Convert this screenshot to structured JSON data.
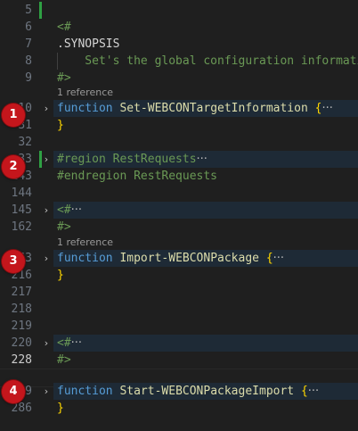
{
  "editor": {
    "lines": [
      {
        "num": "5"
      },
      {
        "num": "6",
        "text": "<#"
      },
      {
        "num": "7",
        "text": ".SYNOPSIS"
      },
      {
        "num": "8",
        "text": "    Set's the global configuration informati"
      },
      {
        "num": "9",
        "text": "#>"
      },
      {
        "ref": "1 reference"
      },
      {
        "num": "10",
        "kw": "function",
        "name": "Set-WEBCONTargetInformation",
        "brace": "{",
        "ellipsis": "···"
      },
      {
        "num": "31",
        "brace": "}"
      },
      {
        "num": "32"
      },
      {
        "num": "33",
        "text": "#region RestRequests",
        "ellipsis": "···"
      },
      {
        "num": "143",
        "text": "#endregion RestRequests"
      },
      {
        "num": "144"
      },
      {
        "num": "145",
        "text": "<#",
        "ellipsis": "···"
      },
      {
        "num": "162",
        "text": "#>"
      },
      {
        "ref": "1 reference"
      },
      {
        "num": "163",
        "kw": "function",
        "name": "Import-WEBCONPackage",
        "brace": "{",
        "ellipsis": "···"
      },
      {
        "num": "216",
        "brace": "}"
      },
      {
        "num": "217"
      },
      {
        "num": "218"
      },
      {
        "num": "219"
      },
      {
        "num": "220",
        "text": "<#",
        "ellipsis": "···"
      },
      {
        "num": "228",
        "text": "#>"
      },
      {
        "num": "229"
      },
      {
        "num": "229",
        "kw": "function",
        "name": "Start-WEBCONPackageImport",
        "brace": "{",
        "ellipsis": "···"
      },
      {
        "num": "286",
        "brace": "}"
      }
    ]
  },
  "annotations": [
    "1",
    "2",
    "3",
    "4"
  ],
  "colors": {
    "background": "#1f1f1f",
    "comment": "#6a9955",
    "keyword": "#569cd6",
    "function_name": "#dcdcaa",
    "brace": "#ffd700",
    "badge": "#c4161c"
  }
}
